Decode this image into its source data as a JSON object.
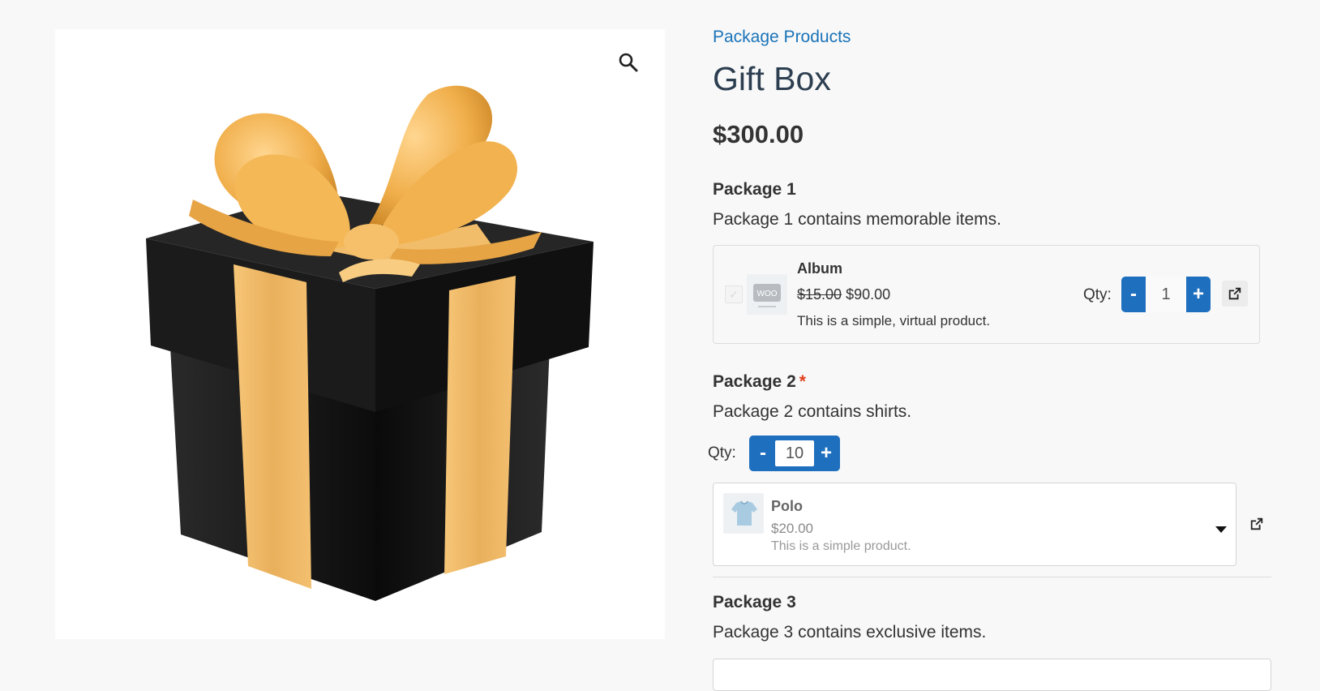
{
  "breadcrumb": "Package Products",
  "product": {
    "title": "Gift Box",
    "price": "$300.00"
  },
  "packages": [
    {
      "title": "Package 1",
      "description": "Package 1 contains memorable items.",
      "item": {
        "name": "Album",
        "regular_price": "$15.00",
        "sale_price": "$90.00",
        "description": "This is a simple, virtual product.",
        "checked": true
      },
      "qty_label": "Qty:",
      "qty": "1"
    },
    {
      "title": "Package 2",
      "required_mark": "*",
      "description": "Package 2 contains shirts.",
      "qty_label": "Qty:",
      "qty": "10",
      "selected": {
        "name": "Polo",
        "price": "$20.00",
        "description": "This is a simple product."
      }
    },
    {
      "title": "Package 3",
      "description": "Package 3 contains exclusive items."
    }
  ],
  "stepper": {
    "minus": "-",
    "plus": "+"
  },
  "thumb1_text": "WOO",
  "icons": {
    "zoom": "magnifier-icon",
    "external": "external-link-icon",
    "dropdown": "caret-down-icon"
  },
  "colors": {
    "accent": "#1f6fbf",
    "link": "#1a73b8",
    "required": "#e2401c",
    "ribbon": "#f1b55a",
    "box": "#141414"
  }
}
